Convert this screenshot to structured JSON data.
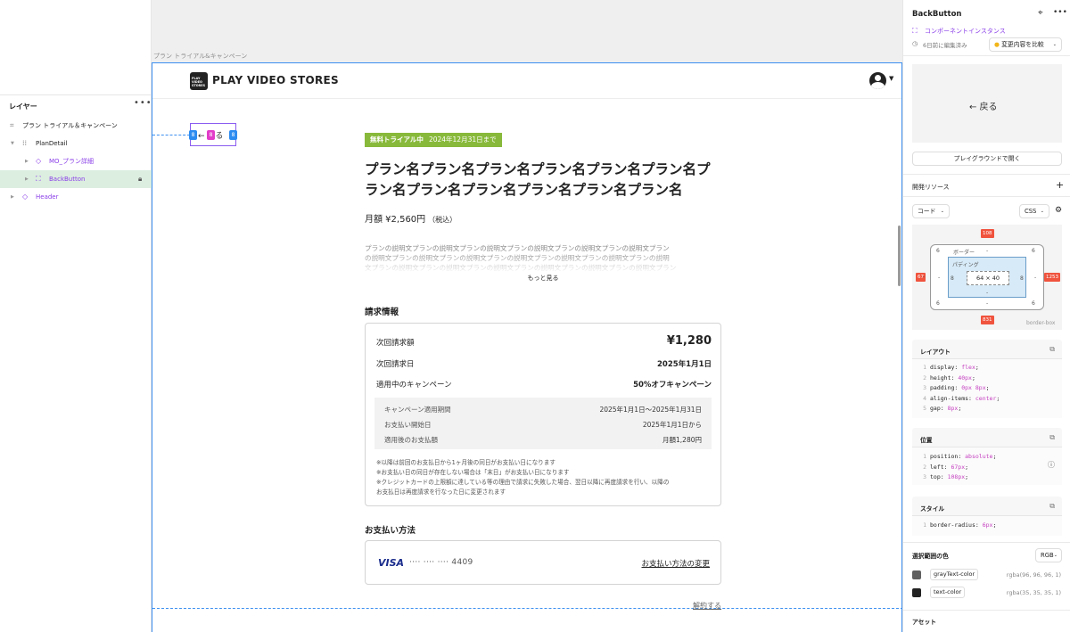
{
  "layers_panel": {
    "title": "レイヤー",
    "more": "•••",
    "items": [
      {
        "label": "プラン トライアル＆キャンペーン"
      },
      {
        "label": "PlanDetail"
      },
      {
        "label": "MO_プラン詳細"
      },
      {
        "label": "BackButton"
      },
      {
        "label": "Header"
      }
    ]
  },
  "canvas": {
    "frame_label": "プラン トライアル&キャンペーン",
    "logo_small": "PLAY VIDEO STORES",
    "brand": "PLAY VIDEO STORES",
    "back_button": {
      "label": "← 戻る",
      "badge_left": "8",
      "badge_mid": "8",
      "badge_right": "8"
    },
    "trial_badge": {
      "label": "無料トライアル中",
      "date": "2024年12月31日まで"
    },
    "plan_title": "プラン名プラン名プラン名プラン名プラン名プラン名プラン名プラン名プラン名プラン名プラン名プラン名",
    "price": "月額 ¥2,560円",
    "price_tax": "（税込）",
    "description": [
      "プランの説明文プランの説明文プランの説明文プランの説明文プランの説明文プランの説明文プラン",
      "の説明文プランの説明文プランの説明文プランの説明文プランの説明文プランの説明文プランの説明",
      "文プランの説明文プランの説明文プランの説明文プランの説明文プランの説明文プランの説明文プラン"
    ],
    "more_link": "もっと見る",
    "billing": {
      "heading": "請求情報",
      "rows": [
        {
          "label": "次回請求額",
          "value": "¥1,280"
        },
        {
          "label": "次回請求日",
          "value": "2025年1月1日"
        },
        {
          "label": "適用中のキャンペーン",
          "value": "50%オフキャンペーン"
        }
      ],
      "campaign_rows": [
        {
          "label": "キャンペーン適用期間",
          "value": "2025年1月1日〜2025年1月31日"
        },
        {
          "label": "お支払い開始日",
          "value": "2025年1月1日から"
        },
        {
          "label": "適用後のお支払額",
          "value": "月額1,280円"
        }
      ],
      "notes": [
        "※以降は前回のお支払日から1ヶ月後の同日がお支払い日になります",
        "※お支払い日の同日が存在しない場合は「末日」がお支払い日になります",
        "※クレジットカードの上限額に達している等の理由で請求に失敗した場合、翌日以降に再度請求を行い、以降の",
        "お支払日は再度請求を行なった日に変更されます"
      ]
    },
    "payment": {
      "heading": "お支払い方法",
      "brand": "VISA",
      "number": "···· ···· ···· 4409",
      "change": "お支払い方法の変更"
    },
    "cancel": "解約する"
  },
  "inspector": {
    "title": "BackButton",
    "instance_label": "コンポーネントインスタンス",
    "edited": "6日前に編集済み",
    "compare": "変更内容を比較",
    "preview_label": "← 戻る",
    "playground": "プレイグラウンドで開く",
    "dev_resources": "開発リソース",
    "code_select": "コード",
    "css_select": "CSS",
    "box_model": {
      "top": "108",
      "left": "67",
      "right": "1253",
      "bottom": "831",
      "border_label": "ボーダー",
      "padding_label": "パディング",
      "size": "64 × 40",
      "margin_v": "6",
      "pad": "8",
      "dash": "-",
      "box_sizing": "border-box"
    },
    "layout": {
      "heading": "レイアウト",
      "lines": [
        {
          "n": "1",
          "p": "display",
          "v": "flex"
        },
        {
          "n": "2",
          "p": "height",
          "v": "40px"
        },
        {
          "n": "3",
          "p": "padding",
          "v": "0px 8px"
        },
        {
          "n": "4",
          "p": "align-items",
          "v": "center"
        },
        {
          "n": "5",
          "p": "gap",
          "v": "8px"
        }
      ]
    },
    "position": {
      "heading": "位置",
      "lines": [
        {
          "n": "1",
          "p": "position",
          "v": "absolute"
        },
        {
          "n": "2",
          "p": "left",
          "v": "67px"
        },
        {
          "n": "3",
          "p": "top",
          "v": "108px"
        }
      ]
    },
    "style": {
      "heading": "スタイル",
      "lines": [
        {
          "n": "1",
          "p": "border-radius",
          "v": "6px"
        }
      ]
    },
    "colors": {
      "heading": "選択範囲の色",
      "mode": "RGB",
      "items": [
        {
          "name": "grayText-color",
          "value": "rgba(96, 96, 96, 1)",
          "hex": "#606060"
        },
        {
          "name": "text-color",
          "value": "rgba(35, 35, 35, 1)",
          "hex": "#232323"
        }
      ]
    },
    "assets": "アセット"
  },
  "colors": {
    "selection": "#3c8ff0",
    "component": "#8a3ee8",
    "trial_green": "#88b93a",
    "margin_tag": "#f0533e"
  }
}
